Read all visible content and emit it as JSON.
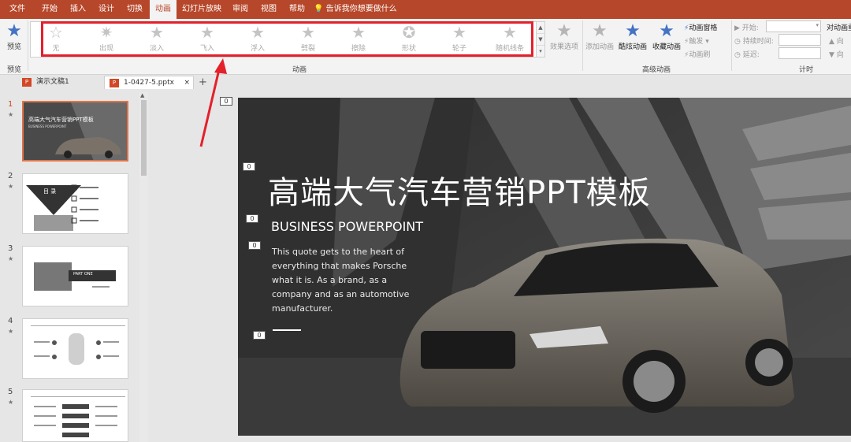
{
  "menu": [
    "文件",
    "开始",
    "插入",
    "设计",
    "切换",
    "动画",
    "幻灯片放映",
    "审阅",
    "视图",
    "帮助"
  ],
  "tellme": "告诉我你想要做什么",
  "ribbon": {
    "preview_label": "预览",
    "preview_group": "预览",
    "animations": [
      "无",
      "出现",
      "淡入",
      "飞入",
      "浮入",
      "劈裂",
      "擦除",
      "形状",
      "轮子",
      "随机线条"
    ],
    "animation_group": "动画",
    "effect_options": "效果选项",
    "add_animation": "添加动画",
    "cool_animation": "酷炫动画",
    "fav_animation": "收藏动画",
    "animation_pane": "动画窗格",
    "trigger": "触发",
    "anim_brush": "动画刷",
    "advanced_group": "高级动画",
    "start_label": "开始:",
    "duration_label": "持续时间:",
    "delay_label": "延迟:",
    "timing_group": "计时",
    "reorder_label": "对动画重",
    "move_earlier": "向",
    "move_later": "向"
  },
  "tabs": [
    {
      "label": "演示文稿1"
    },
    {
      "label": "1-0427-5.pptx",
      "close": "×"
    }
  ],
  "add_tab": "+",
  "slides": [
    {
      "num": "1",
      "mark": "★",
      "title": "高端大气汽车营销PPT模板",
      "sub": "BUSINESS POWERPOINT"
    },
    {
      "num": "2",
      "mark": "★",
      "title": "目 录"
    },
    {
      "num": "3",
      "mark": "★",
      "title": "PART ONE"
    },
    {
      "num": "4",
      "mark": "★"
    },
    {
      "num": "5",
      "mark": "★"
    }
  ],
  "slide": {
    "title": "高端大气汽车营销PPT模板",
    "subtitle": "BUSINESS POWERPOINT",
    "body": "This quote gets to the heart of everything that makes Porsche what it is. As a brand, as a company and as an automotive manufacturer.",
    "anim_tags": [
      "0",
      "0",
      "0",
      "0",
      "0"
    ]
  },
  "colors": {
    "accent": "#b7472a",
    "highlight": "#e4202b",
    "star_blue": "#4472c4"
  }
}
